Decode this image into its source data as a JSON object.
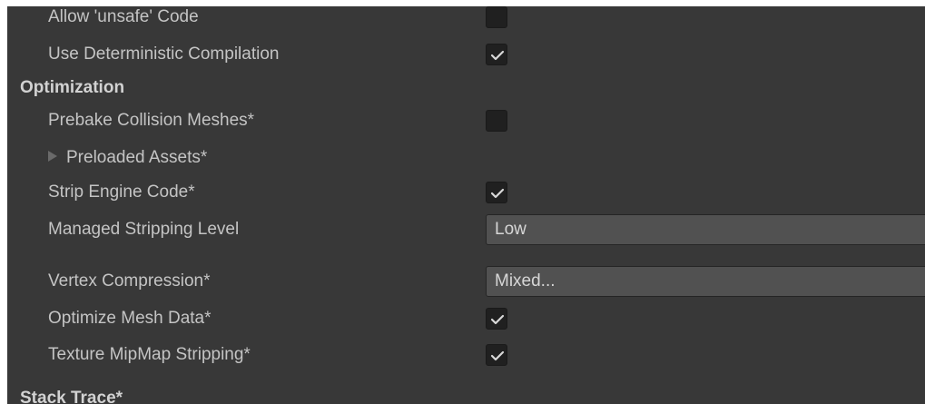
{
  "settings": {
    "allow_unsafe_code": {
      "label": "Allow 'unsafe' Code",
      "checked": false
    },
    "use_deterministic_compilation": {
      "label": "Use Deterministic Compilation",
      "checked": true
    }
  },
  "optimization": {
    "header": "Optimization",
    "prebake_collision_meshes": {
      "label": "Prebake Collision Meshes*",
      "checked": false
    },
    "preloaded_assets": {
      "label": "Preloaded Assets*",
      "expanded": false
    },
    "strip_engine_code": {
      "label": "Strip Engine Code*",
      "checked": true
    },
    "managed_stripping_level": {
      "label": "Managed Stripping Level",
      "value": "Low"
    },
    "vertex_compression": {
      "label": "Vertex Compression*",
      "value": "Mixed..."
    },
    "optimize_mesh_data": {
      "label": "Optimize Mesh Data*",
      "checked": true
    },
    "texture_mipmap_stripping": {
      "label": "Texture MipMap Stripping*",
      "checked": true
    }
  },
  "stack_trace": {
    "header": "Stack Trace*"
  },
  "icons": {
    "checkmark": "checkmark-icon",
    "foldout": "triangle-right-icon"
  },
  "colors": {
    "panel_background": "#383838",
    "checkbox_background": "#202020",
    "dropdown_background": "#515151",
    "text": "#c4c4c4"
  }
}
